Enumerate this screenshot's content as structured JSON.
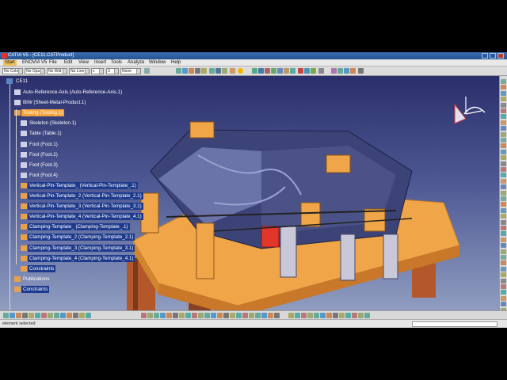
{
  "window": {
    "title": "CATIA V5 - [CE11.CATProduct]"
  },
  "menubar": {
    "items": [
      {
        "label": "Start",
        "active": true
      },
      {
        "label": "ENOVIA V5"
      },
      {
        "label": "File"
      },
      {
        "label": "Edit"
      },
      {
        "label": "View"
      },
      {
        "label": "Insert"
      },
      {
        "label": "Tools"
      },
      {
        "label": "Analyze"
      },
      {
        "label": "Window"
      },
      {
        "label": "Help"
      }
    ]
  },
  "toolbar": {
    "color_combo": "No Colo",
    "opacity_combo": "No Opa",
    "width_combo": "No Wid",
    "linetype_combo": "No Line",
    "point_combo": "x",
    "layer_combo": "3",
    "none_combo": "None"
  },
  "tree": {
    "root": "CE11",
    "items": [
      {
        "label": "Auto-Reference-Axis (Auto-Reference-Axis.1)"
      },
      {
        "label": "BIW (Sheet-Metal-Product.1)"
      },
      {
        "label": "Tooling (Tooling.1)",
        "state": "selected"
      },
      {
        "label": "Skeleton (Skeleton.1)"
      },
      {
        "label": "Table (Table.1)"
      },
      {
        "label": "Foot (Foot.1)"
      },
      {
        "label": "Foot (Foot.2)"
      },
      {
        "label": "Foot (Foot.3)"
      },
      {
        "label": "Foot (Foot.4)"
      },
      {
        "label": "Vertical-Pin-Template_ (Vertical-Pin-Template_.1)",
        "state": "highlight"
      },
      {
        "label": "Vertical-Pin-Template_2 (Vertical-Pin-Template_2.1)",
        "state": "highlight"
      },
      {
        "label": "Vertical-Pin-Template_3 (Vertical-Pin-Template_3.1)",
        "state": "highlight"
      },
      {
        "label": "Vertical-Pin-Template_4 (Vertical-Pin-Template_4.1)",
        "state": "highlight"
      },
      {
        "label": "Clamping-Template_ (Clamping-Template_.1)",
        "state": "highlight"
      },
      {
        "label": "Clamping-Template_2 (Clamping-Template_2.1)",
        "state": "highlight"
      },
      {
        "label": "Clamping-Template_3 (Clamping-Template_3.1)",
        "state": "highlight"
      },
      {
        "label": "Clamping-Template_4 (Clamping-Template_4.1)",
        "state": "highlight"
      },
      {
        "label": "Constraints",
        "state": "highlight"
      },
      {
        "label": "Publications"
      },
      {
        "label": "Constraints",
        "state": "highlight"
      }
    ]
  },
  "status": {
    "message": "element selected"
  },
  "colors": {
    "selection": "#f4a23c",
    "highlight": "#1e3a8c",
    "model_orange": "#f0a648",
    "viewport_top": "#2a2f6b",
    "viewport_bottom": "#93a0c2"
  }
}
